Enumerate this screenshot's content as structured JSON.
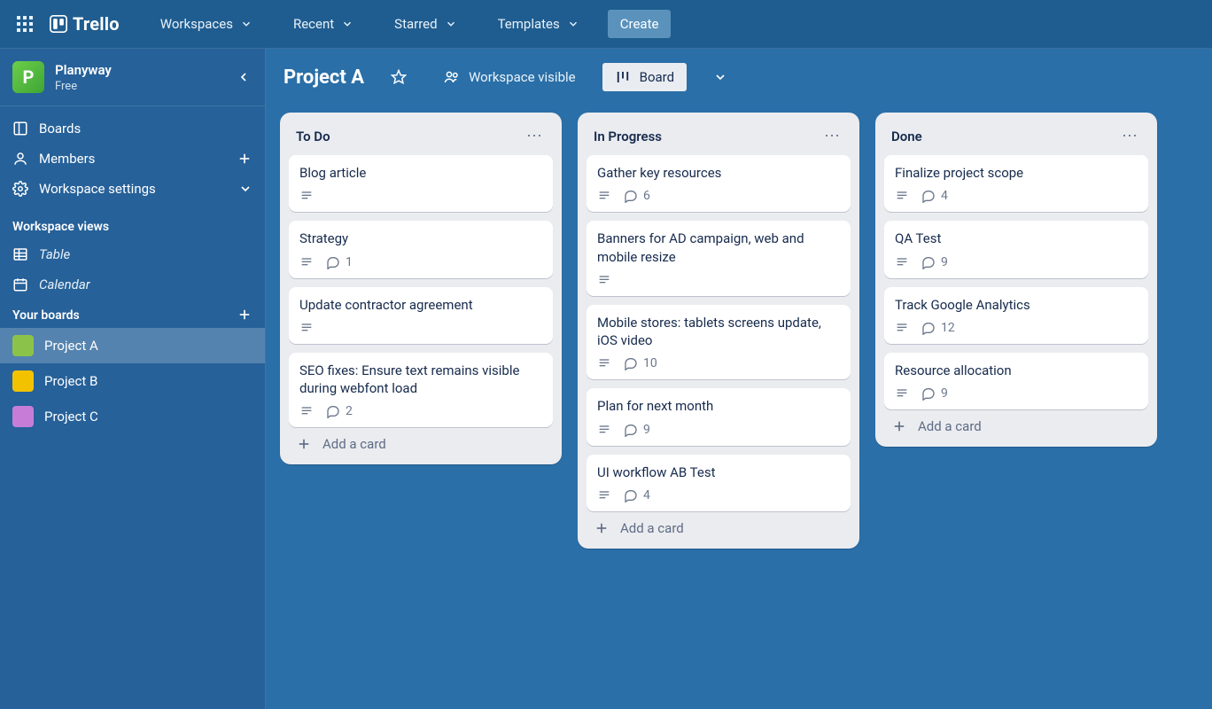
{
  "topbar": {
    "brand": "Trello",
    "menu": [
      "Workspaces",
      "Recent",
      "Starred",
      "Templates"
    ],
    "create": "Create"
  },
  "workspace": {
    "name": "Planyway",
    "plan": "Free",
    "logo_letter": "P"
  },
  "sidebar": {
    "items": [
      {
        "label": "Boards"
      },
      {
        "label": "Members"
      },
      {
        "label": "Workspace settings"
      }
    ],
    "views_heading": "Workspace views",
    "views": [
      {
        "label": "Table"
      },
      {
        "label": "Calendar"
      }
    ],
    "boards_heading": "Your boards",
    "boards": [
      {
        "label": "Project A",
        "color": "#8bc34a",
        "active": true
      },
      {
        "label": "Project B",
        "color": "#f2c200",
        "active": false
      },
      {
        "label": "Project C",
        "color": "#c77dd8",
        "active": false
      }
    ]
  },
  "board": {
    "title": "Project A",
    "visibility": "Workspace visible",
    "view_label": "Board"
  },
  "lists": [
    {
      "title": "To Do",
      "cards": [
        {
          "title": "Blog article",
          "desc": true
        },
        {
          "title": "Strategy",
          "desc": true,
          "comments": 1
        },
        {
          "title": "Update contractor agreement",
          "desc": true
        },
        {
          "title": "SEO fixes: Ensure text remains visible during webfont load",
          "desc": true,
          "comments": 2
        }
      ],
      "add": "Add a card"
    },
    {
      "title": "In Progress",
      "cards": [
        {
          "title": "Gather key resources",
          "desc": true,
          "comments": 6
        },
        {
          "title": "Banners for AD campaign, web and mobile resize",
          "desc": true
        },
        {
          "title": "Mobile stores: tablets screens update, iOS video",
          "desc": true,
          "comments": 10
        },
        {
          "title": "Plan for next month",
          "desc": true,
          "comments": 9
        },
        {
          "title": "UI workflow AB Test",
          "desc": true,
          "comments": 4
        }
      ],
      "add": "Add a card"
    },
    {
      "title": "Done",
      "cards": [
        {
          "title": "Finalize project scope",
          "desc": true,
          "comments": 4
        },
        {
          "title": "QA Test",
          "desc": true,
          "comments": 9
        },
        {
          "title": "Track Google Analytics",
          "desc": true,
          "comments": 12
        },
        {
          "title": "Resource allocation",
          "desc": true,
          "comments": 9
        }
      ],
      "add": "Add a card"
    }
  ]
}
